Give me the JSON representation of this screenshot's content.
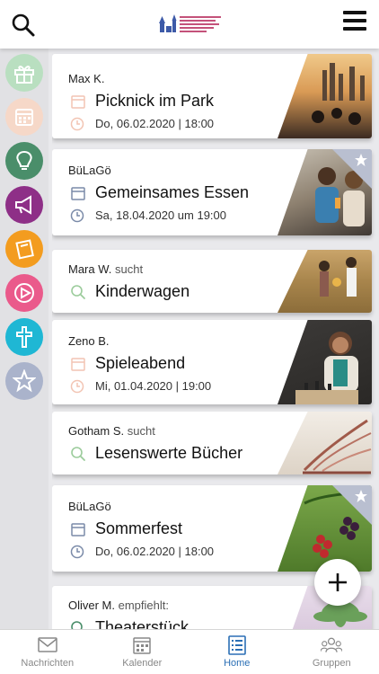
{
  "colors": {
    "accent": "#2b6fb5",
    "icon_calendar": "#f2c4b3",
    "icon_search": "#9ccc9c",
    "icon_clock": "#f2c4b3"
  },
  "header": {
    "search_icon": "search-icon",
    "menu_icon": "hamburger-menu-icon"
  },
  "sidebar": {
    "items": [
      {
        "name": "gift",
        "color": "#b9dfc0"
      },
      {
        "name": "calendar",
        "color": "#f6d8c8"
      },
      {
        "name": "lightbulb",
        "color": "#4a8e6a"
      },
      {
        "name": "megaphone",
        "color": "#8e2f87"
      },
      {
        "name": "note",
        "color": "#f39c1f"
      },
      {
        "name": "play",
        "color": "#ea5a8b"
      },
      {
        "name": "cross",
        "color": "#1fb7d4"
      },
      {
        "name": "star",
        "color": "#aab3cb"
      }
    ]
  },
  "cards": [
    {
      "author": "Max K.",
      "verb": "",
      "title": "Picknick im Park",
      "date": "Do, 06.02.2020 | 18:00",
      "kind": "event",
      "starred": false
    },
    {
      "author": "BüLaGö",
      "verb": "",
      "title": "Gemeinsames Essen",
      "date": "Sa, 18.04.2020 um 19:00",
      "kind": "event",
      "starred": true
    },
    {
      "author": "Mara W.",
      "verb": "sucht",
      "title": "Kinderwagen",
      "date": "",
      "kind": "search",
      "starred": false
    },
    {
      "author": "Zeno B.",
      "verb": "",
      "title": "Spieleabend",
      "date": "Mi, 01.04.2020 | 19:00",
      "kind": "event",
      "starred": false
    },
    {
      "author": "Gotham S.",
      "verb": "sucht",
      "title": "Lesenswerte Bücher",
      "date": "",
      "kind": "search",
      "starred": false
    },
    {
      "author": "BüLaGö",
      "verb": "",
      "title": "Sommerfest",
      "date": "Do, 06.02.2020 | 18:00",
      "kind": "event",
      "starred": true
    },
    {
      "author": "Oliver M.",
      "verb": "empfiehlt:",
      "title": "Theaterstück",
      "date": "",
      "kind": "recommend",
      "starred": false
    }
  ],
  "fab": {
    "icon": "plus-icon"
  },
  "tabbar": {
    "tabs": [
      {
        "label": "Nachrichten",
        "icon": "envelope-icon",
        "active": false
      },
      {
        "label": "Kalender",
        "icon": "calendar-icon",
        "active": false
      },
      {
        "label": "Home",
        "icon": "list-icon",
        "active": true
      },
      {
        "label": "Gruppen",
        "icon": "group-icon",
        "active": false
      }
    ]
  }
}
